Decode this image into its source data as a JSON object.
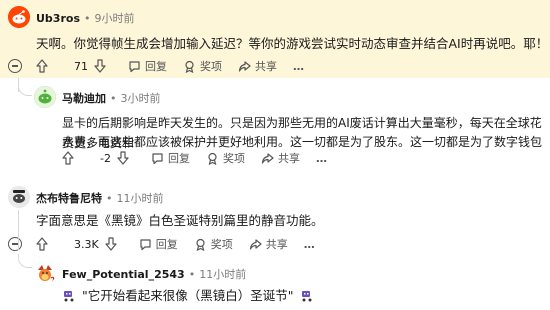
{
  "comments": [
    {
      "username": "Ub3ros",
      "time": "9小时前",
      "text": "天啊。你觉得帧生成会增加输入延迟？等你的游戏尝试实时动态审查并结合AI时再说吧。耶！",
      "votes": "71",
      "reply_label": "回复",
      "award_label": "奖项",
      "share_label": "共享",
      "more": "…"
    },
    {
      "username": "马勒迪加",
      "time": "3小时前",
      "text_line1": "显卡的后期影响是昨天发生的。只是因为那些无用的AI废话计算出大量毫秒，每天在全球花费更多电费和",
      "text_line2": "水费，而这些都应该被保护并更好地利用。这一切都是为了股东。这一切都是为了数字钱包",
      "votes": "-2",
      "reply_label": "回复",
      "award_label": "奖项",
      "share_label": "共享",
      "more": "…"
    },
    {
      "username": "杰布特鲁尼特",
      "time": "11小时前",
      "text": "字面意思是《黑镜》白色圣诞特别篇里的静音功能。",
      "votes": "3.3K",
      "reply_label": "回复",
      "award_label": "奖项",
      "share_label": "共享",
      "more": "…"
    },
    {
      "username": "Few_Potential_2543",
      "time": "11小时前",
      "text": "\"它开始看起来很像（黑镜白）圣诞节\""
    }
  ],
  "colors": {
    "highlight_bg": "#fdf6d9",
    "thread_line": "#d8d8d8",
    "text": "#1a1a1b",
    "muted": "#7c7c7c"
  }
}
